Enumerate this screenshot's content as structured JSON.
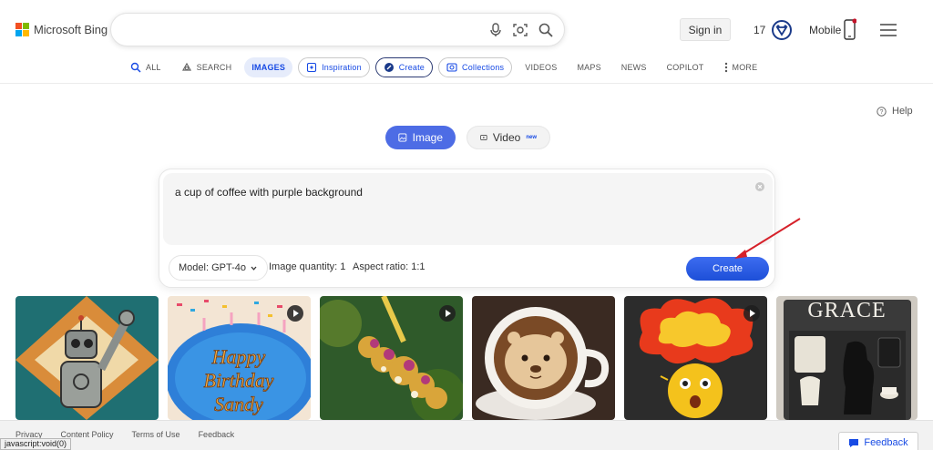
{
  "header": {
    "brand": "Microsoft Bing",
    "search_value": "",
    "signin_label": "Sign in",
    "points": "17",
    "mobile_label": "Mobile"
  },
  "nav": {
    "items": [
      {
        "label": "ALL",
        "icon": "search-icon"
      },
      {
        "label": "SEARCH",
        "icon": "copilot-icon"
      },
      {
        "label": "IMAGES",
        "active": true
      },
      {
        "label": "Inspiration",
        "icon": "sparkle-icon"
      },
      {
        "label": "Create",
        "icon": "create-icon"
      },
      {
        "label": "Collections",
        "icon": "collections-icon"
      },
      {
        "label": "VIDEOS"
      },
      {
        "label": "MAPS"
      },
      {
        "label": "NEWS"
      },
      {
        "label": "COPILOT"
      },
      {
        "label": "MORE",
        "icon": "more-vertical-icon"
      }
    ]
  },
  "help_label": "Help",
  "toggle": {
    "image_label": "Image",
    "video_label": "Video",
    "video_badge": "new",
    "selected": "Image"
  },
  "prompt": {
    "text": "a cup of coffee with purple background",
    "model": "Model: GPT-4o",
    "quantity": "Image quantity: 1",
    "aspect": "Aspect ratio: 1:1",
    "create_label": "Create"
  },
  "gallery": {
    "items": [
      {
        "name": "robot-cheering",
        "video": false
      },
      {
        "name": "birthday-cake",
        "video": true
      },
      {
        "name": "flower-bouquet",
        "video": true
      },
      {
        "name": "otter-latte",
        "video": false
      },
      {
        "name": "exploding-emoji",
        "video": true
      },
      {
        "name": "grace-dog",
        "video": false,
        "caption": "GRACE"
      }
    ]
  },
  "footer": {
    "links": [
      "Privacy",
      "Content Policy",
      "Terms of Use",
      "Feedback"
    ],
    "feedback_label": "Feedback"
  },
  "status_text": "javascript:void(0)",
  "colors": {
    "accent": "#174ae4",
    "create_button": "#1d4fd8",
    "image_toggle": "#4d6ce5",
    "annotation_arrow": "#d6212a"
  }
}
